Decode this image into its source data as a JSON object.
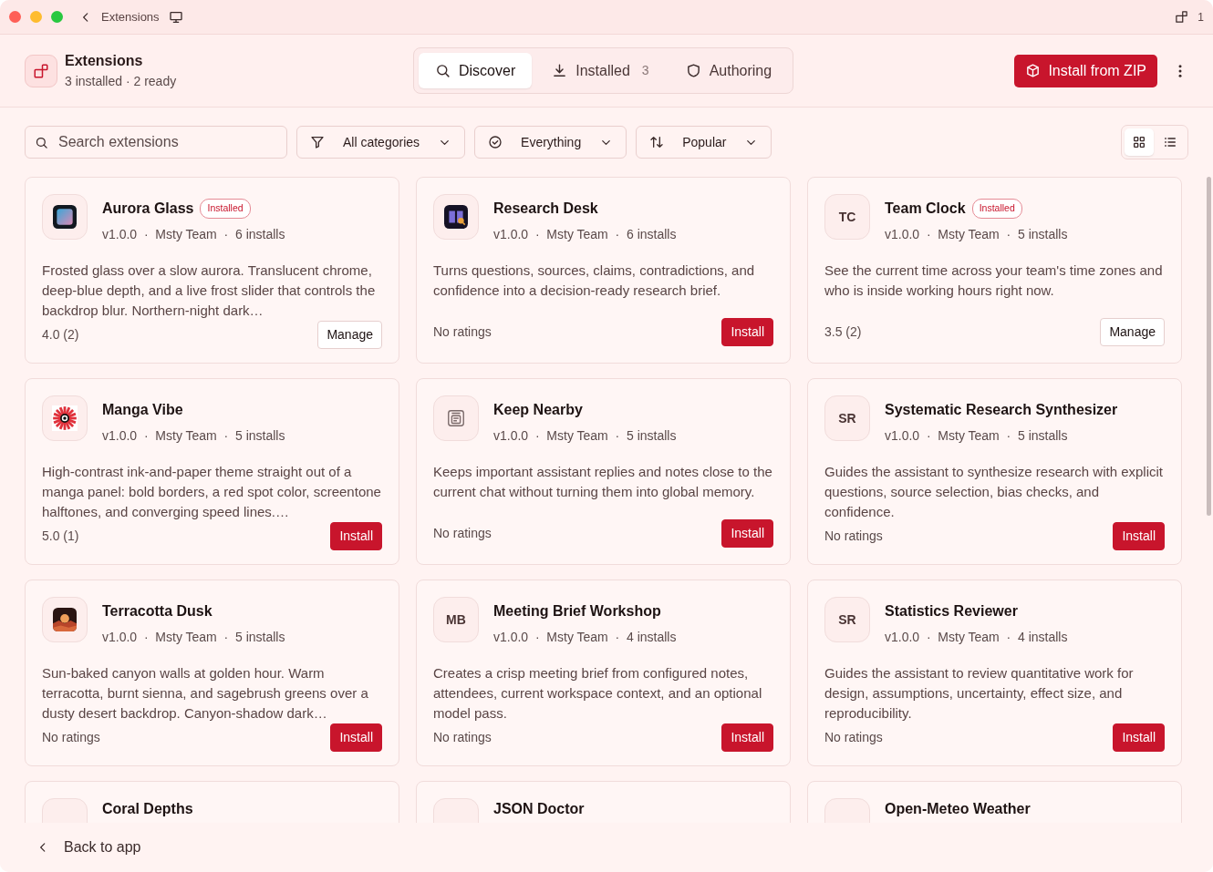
{
  "window": {
    "title": "Extensions",
    "badge_count": "1"
  },
  "header": {
    "title": "Extensions",
    "subtitle": "3 installed · 2 ready",
    "primary_button": "Install from ZIP"
  },
  "tabs": [
    {
      "label": "Discover",
      "selected": true
    },
    {
      "label": "Installed",
      "count": "3",
      "selected": false
    },
    {
      "label": "Authoring",
      "selected": false
    }
  ],
  "search": {
    "placeholder": "Search extensions"
  },
  "filters": [
    {
      "label": "All categories"
    },
    {
      "label": "Everything"
    },
    {
      "label": "Popular"
    }
  ],
  "view_toggle": [
    {
      "kind": "grid",
      "selected": true
    },
    {
      "kind": "list",
      "selected": false
    }
  ],
  "extensions": [
    {
      "name": "Aurora Glass",
      "kind": "aurora",
      "badge": "Installed",
      "meta": "v1.0.0  ·  Msty Team  ·  6 installs",
      "description": "Frosted glass over a slow aurora. Translucent chrome, deep-blue depth, and a live frost slider that controls the backdrop blur. Northern-night dark…",
      "rating": "4.0 (2)",
      "action": "Manage"
    },
    {
      "name": "Research Desk",
      "kind": "book",
      "meta": "v1.0.0  ·  Msty Team  ·  6 installs",
      "description": "Turns questions, sources, claims, contradictions, and confidence into a decision-ready research brief.",
      "rating": "No ratings",
      "action": "Install"
    },
    {
      "name": "Team Clock",
      "kind": "initials",
      "initials": "TC",
      "badge": "Installed",
      "meta": "v1.0.0  ·  Msty Team  ·  5 installs",
      "description": "See the current time across your team's time zones and who is inside working hours right now.",
      "rating": "3.5 (2)",
      "action": "Manage"
    },
    {
      "name": "Manga Vibe",
      "kind": "burst",
      "meta": "v1.0.0  ·  Msty Team  ·  5 installs",
      "description": "High-contrast ink-and-paper theme straight out of a manga panel: bold borders, a red spot color, screentone halftones, and converging speed lines.…",
      "rating": "5.0 (1)",
      "action": "Install"
    },
    {
      "name": "Keep Nearby",
      "kind": "note",
      "meta": "v1.0.0  ·  Msty Team  ·  5 installs",
      "description": "Keeps important assistant replies and notes close to the current chat without turning them into global memory.",
      "rating": "No ratings",
      "action": "Install"
    },
    {
      "name": "Systematic Research Synthesizer",
      "kind": "initials",
      "initials": "SR",
      "meta": "v1.0.0  ·  Msty Team  ·  5 installs",
      "description": "Guides the assistant to synthesize research with explicit questions, source selection, bias checks, and confidence.",
      "rating": "No ratings",
      "action": "Install"
    },
    {
      "name": "Terracotta Dusk",
      "kind": "dusk",
      "meta": "v1.0.0  ·  Msty Team  ·  5 installs",
      "description": "Sun-baked canyon walls at golden hour. Warm terracotta, burnt sienna, and sagebrush greens over a dusty desert backdrop. Canyon-shadow dark…",
      "rating": "No ratings",
      "action": "Install"
    },
    {
      "name": "Meeting Brief Workshop",
      "kind": "initials",
      "initials": "MB",
      "meta": "v1.0.0  ·  Msty Team  ·  4 installs",
      "description": "Creates a crisp meeting brief from configured notes, attendees, current workspace context, and an optional model pass.",
      "rating": "No ratings",
      "action": "Install"
    },
    {
      "name": "Statistics Reviewer",
      "kind": "initials",
      "initials": "SR",
      "meta": "v1.0.0  ·  Msty Team  ·  4 installs",
      "description": "Guides the assistant to review quantitative work for design, assumptions, uncertainty, effect size, and reproducibility.",
      "rating": "No ratings",
      "action": "Install"
    }
  ],
  "partial_extensions": [
    {
      "name": "Coral Depths"
    },
    {
      "name": "JSON Doctor"
    },
    {
      "name": "Open-Meteo Weather"
    }
  ],
  "footer": {
    "back_link": "Back to app"
  }
}
